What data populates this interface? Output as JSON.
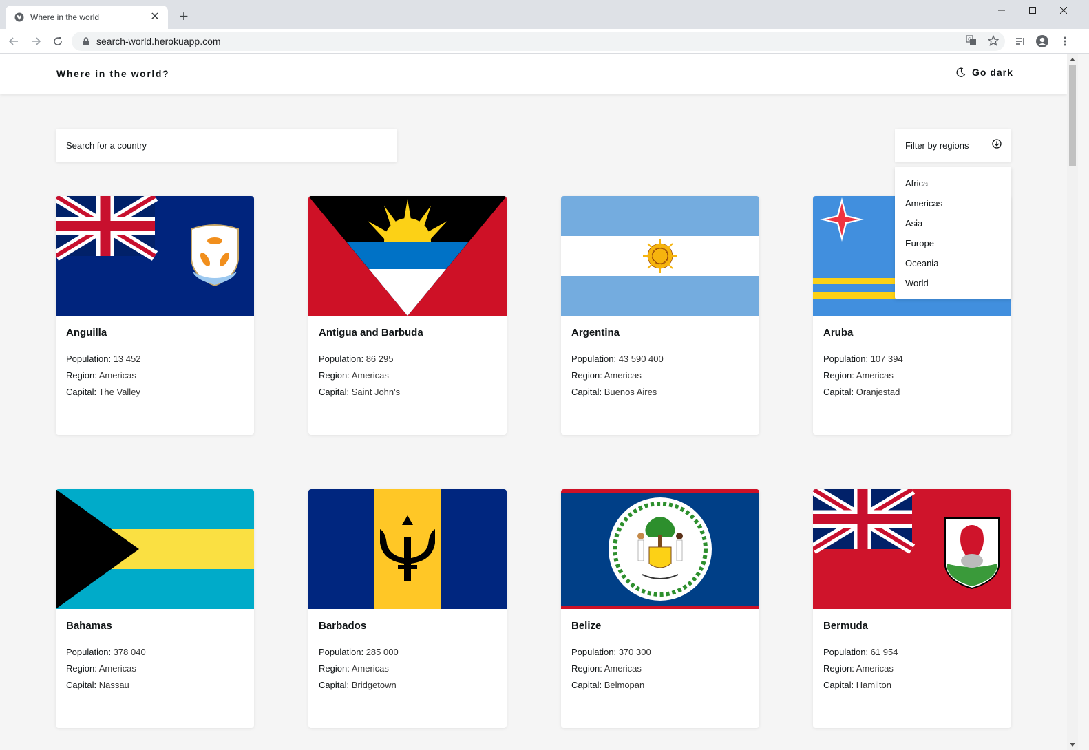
{
  "browser": {
    "tab_title": "Where in the world",
    "url": "search-world.herokuapp.com"
  },
  "header": {
    "title": "Where in the world?",
    "dark_label": "Go dark"
  },
  "search": {
    "placeholder": "Search for a country"
  },
  "filter": {
    "label": "Filter by regions",
    "options": [
      "Africa",
      "Americas",
      "Asia",
      "Europe",
      "Oceania",
      "World"
    ]
  },
  "labels": {
    "population": "Population:",
    "region": "Region:",
    "capital": "Capital:"
  },
  "countries": [
    {
      "name": "Anguilla",
      "population": "13 452",
      "region": "Americas",
      "capital": "The Valley",
      "flag": "anguilla"
    },
    {
      "name": "Antigua and Barbuda",
      "population": "86 295",
      "region": "Americas",
      "capital": "Saint John's",
      "flag": "antigua"
    },
    {
      "name": "Argentina",
      "population": "43 590 400",
      "region": "Americas",
      "capital": "Buenos Aires",
      "flag": "argentina"
    },
    {
      "name": "Aruba",
      "population": "107 394",
      "region": "Americas",
      "capital": "Oranjestad",
      "flag": "aruba"
    },
    {
      "name": "Bahamas",
      "population": "378 040",
      "region": "Americas",
      "capital": "Nassau",
      "flag": "bahamas"
    },
    {
      "name": "Barbados",
      "population": "285 000",
      "region": "Americas",
      "capital": "Bridgetown",
      "flag": "barbados"
    },
    {
      "name": "Belize",
      "population": "370 300",
      "region": "Americas",
      "capital": "Belmopan",
      "flag": "belize"
    },
    {
      "name": "Bermuda",
      "population": "61 954",
      "region": "Americas",
      "capital": "Hamilton",
      "flag": "bermuda"
    }
  ],
  "colors": {
    "page_bg": "#f5f5f5",
    "card_bg": "#ffffff",
    "text": "#111517"
  }
}
